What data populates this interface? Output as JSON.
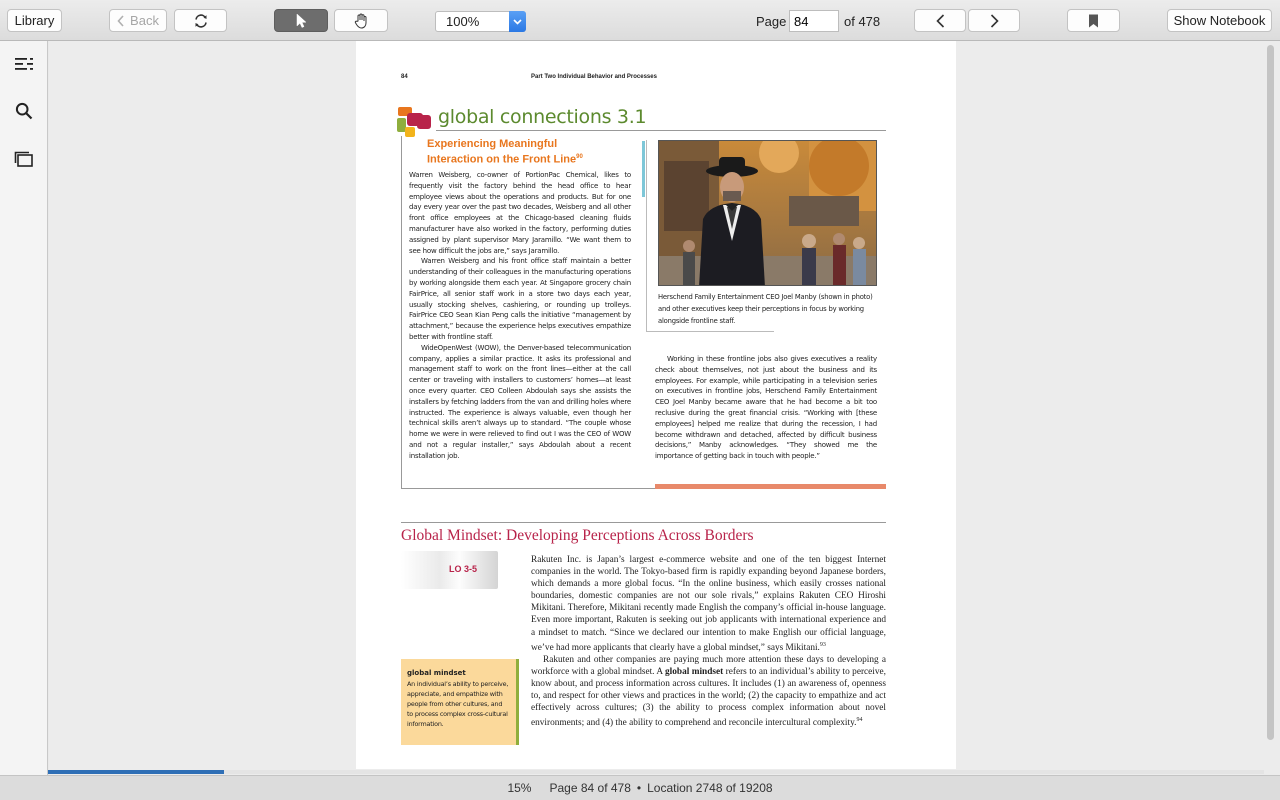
{
  "toolbar": {
    "library_label": "Library",
    "back_label": "Back",
    "zoom_value": "100%",
    "page_label": "Page",
    "page_value": "84",
    "page_of": "of 478",
    "notebook_label": "Show Notebook"
  },
  "status": {
    "percent": "15%",
    "page_text": "Page 84 of 478",
    "separator": "•",
    "location_text": "Location 2748 of 19208",
    "progress_fraction": 0.145
  },
  "book": {
    "page_number": "84",
    "running_head": "Part Two   Individual Behavior and Processes",
    "gc_title": "global connections 3.1",
    "gc_subtitle_line1": "Experiencing Meaningful",
    "gc_subtitle_line2": "Interaction on the Front Line",
    "gc_subtitle_sup": "90",
    "col1_p1": "Warren Weisberg, co-owner of PortionPac Chemical, likes to frequently visit the factory behind the head office to hear employee views about the operations and products. But for one day every year over the past two decades, Weisberg and all other front office employees at the Chicago-based cleaning fluids manufacturer have also worked in the factory, performing duties assigned by plant supervisor Mary Jaramillo. “We want them to see how difficult the jobs are,” says Jaramillo.",
    "col1_p2": "Warren Weisberg and his front office staff maintain a better understanding of their colleagues in the manufacturing operations by working alongside them each year. At Singapore grocery chain FairPrice, all senior staff work in a store two days each year, usually stocking shelves, cashiering, or rounding up trolleys. FairPrice CEO Sean Kian Peng calls the initiative “management by attachment,” because the experience helps executives empathize better with frontline staff.",
    "col1_p3": "WideOpenWest (WOW), the Denver-based telecommunication company, applies a similar practice. It asks its professional and management staff to work on the front lines—either at the call center or traveling with installers to customers’ homes—at least once every quarter. CEO Colleen Abdoulah says she assists the installers by fetching ladders from the van and drilling holes where instructed. The experience is always valuable, even though her technical skills aren’t always up to standard. “The couple whose home we were in were relieved to find out I was the CEO of WOW and not a regular installer,” says Abdoulah about a recent installation job.",
    "caption": "Herschend Family Entertainment CEO Joel Manby (shown in photo) and other executives keep their perceptions in focus by working alongside frontline staff.",
    "col2_p1": "Working in these frontline jobs also gives executives a reality check about themselves, not just about the business and its employees. For example, while participating in a television series on executives in frontline jobs, Herschend Family Entertainment CEO Joel Manby became aware that he had become a bit too reclusive during the great financial crisis. “Working with [these employees] helped me realize that during the recession, I had become withdrawn and detached, affected by difficult business decisions,” Manby acknowledges. “They showed me the importance of getting back in touch with people.”",
    "section_title": "Global Mindset: Developing Perceptions Across Borders",
    "lo_badge": "LO 3-5",
    "body_p1": "Rakuten Inc. is Japan’s largest e-commerce website and one of the ten biggest Internet companies in the world. The Tokyo-based firm is rapidly expanding beyond Japanese borders, which demands a more global focus. “In the online business, which easily crosses national boundaries, domestic companies are not our sole rivals,” explains Rakuten CEO Hiroshi Mikitani. Therefore, Mikitani recently made English the company’s official in-house language. Even more important, Rakuten is seeking out job applicants with international experience and a mindset to match. “Since we declared our intention to make English our official language, we’ve had more applicants that clearly have a global mindset,” says Mikitani.",
    "body_p1_sup": "93",
    "body_p2_a": "Rakuten and other companies are paying much more attention these days to developing a workforce with a global mindset. A ",
    "body_p2_bold": "global mindset",
    "body_p2_b": " refers to an individual’s ability to perceive, know about, and process information across cultures. It includes (1) an awareness of, openness to, and respect for other views and practices in the world; (2) the capacity to empathize and act effectively across cultures; (3) the ability to process complex information about novel environments; and (4) the ability to comprehend and reconcile intercultural complexity.",
    "body_p2_sup": "94",
    "gm_term": "global mindset",
    "gm_def": "An individual’s ability to perceive, appreciate, and empathize with people from other cultures, and to process complex cross-cultural information."
  },
  "icons": [
    "chevron-left-icon",
    "refresh-icon",
    "pointer-icon",
    "hand-icon",
    "chevron-down-icon",
    "bookmark-icon",
    "toc-icon",
    "search-icon",
    "pages-icon"
  ]
}
